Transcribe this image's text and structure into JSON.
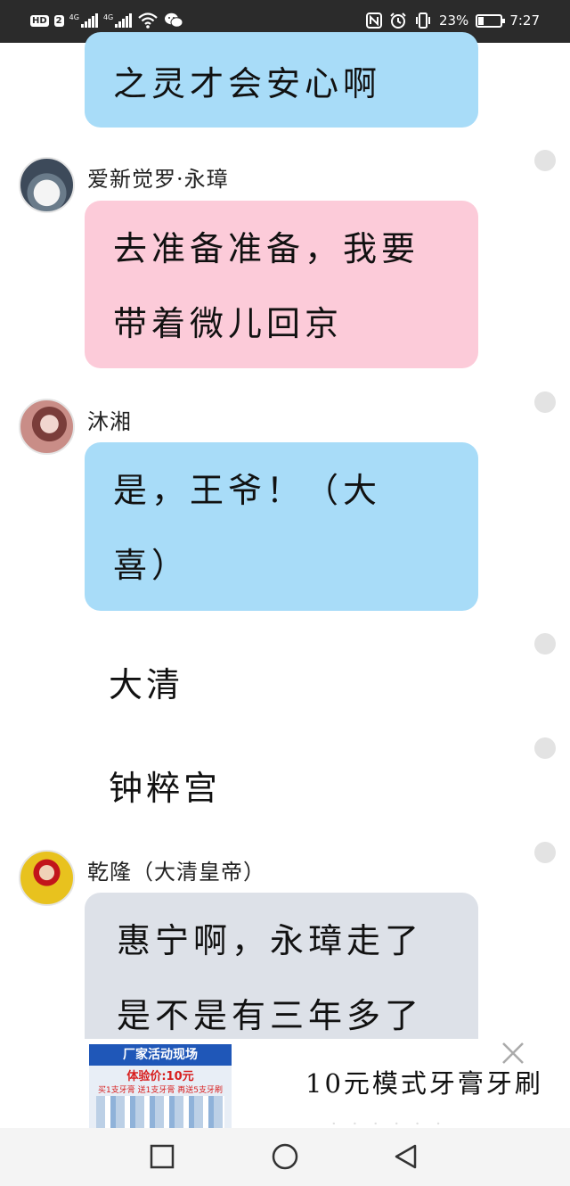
{
  "status_bar": {
    "left_icons": [
      "hd-icon",
      "signal-icon",
      "signal-icon",
      "wifi-icon",
      "wechat-icon"
    ],
    "hd_label": "HD",
    "sim_label": "2",
    "network1": "4G",
    "network2": "4G",
    "battery_percent": "23%",
    "battery_level": 0.23,
    "time": "7:27"
  },
  "messages": [
    {
      "type": "bubble",
      "color": "blue",
      "lines": [
        "之灵才会安心啊"
      ]
    },
    {
      "type": "bubble",
      "sender": "爱新觉罗·永璋",
      "color": "pink",
      "lines": [
        "去准备准备，我要",
        "带着微儿回京"
      ]
    },
    {
      "type": "bubble",
      "sender": "沐湘",
      "color": "blue",
      "lines": [
        "是，王爷！（大",
        "喜）"
      ]
    },
    {
      "type": "narration",
      "text": "大清"
    },
    {
      "type": "narration",
      "text": "钟粹宫"
    },
    {
      "type": "bubble",
      "sender": "乾隆（大清皇帝）",
      "color": "grey",
      "lines": [
        "惠宁啊，永璋走了",
        "是不是有三年多了"
      ]
    }
  ],
  "ad": {
    "image_header": "厂家活动现场",
    "image_price": "体验价:10元",
    "image_sub": "买1支牙膏 送1支牙膏 再送5支牙刷",
    "title": "10元模式牙膏牙刷",
    "close_icon": "close-icon"
  },
  "nav_bar": {
    "icons": [
      "recent-apps-icon",
      "home-icon",
      "back-icon"
    ]
  },
  "colors": {
    "blue_bubble": "#a8dcf8",
    "pink_bubble": "#fccbd9",
    "grey_bubble": "#dde1e8",
    "status_bar": "#2b2b2b"
  }
}
